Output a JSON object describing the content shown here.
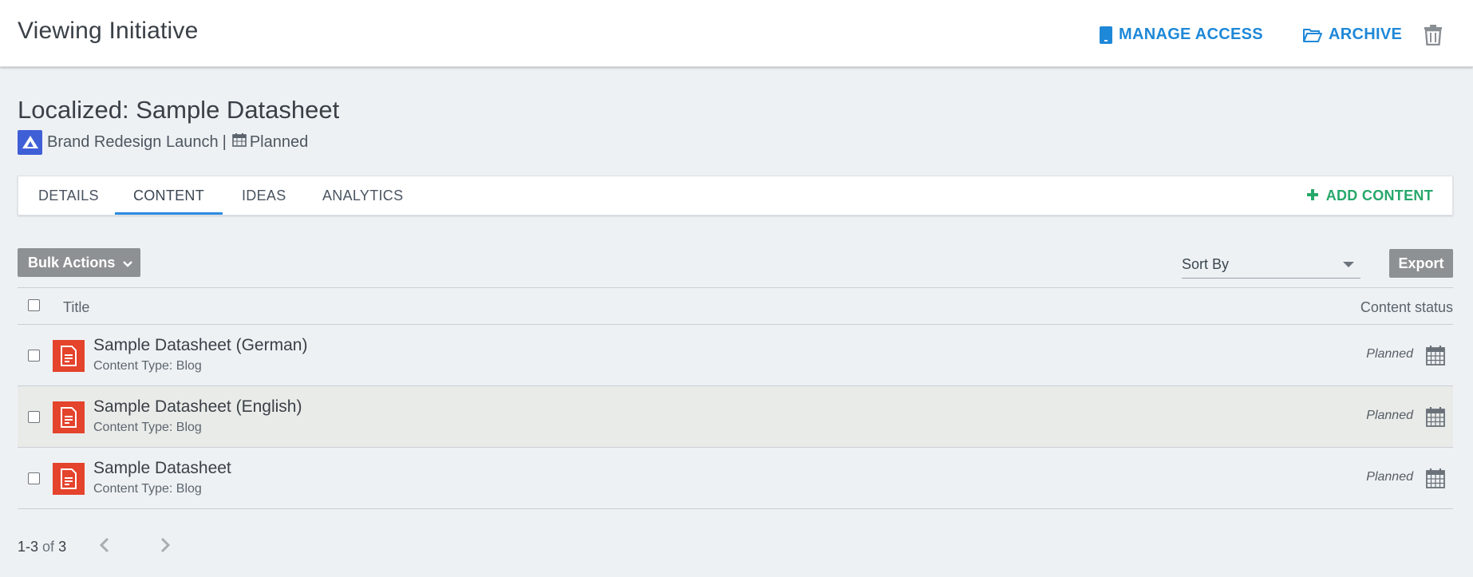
{
  "header": {
    "title": "Viewing Initiative",
    "manage_access_label": "MANAGE ACCESS",
    "archive_label": "ARCHIVE",
    "icons": [
      "tablet-icon",
      "folder-open-icon",
      "trash-icon"
    ]
  },
  "page": {
    "title": "Localized: Sample Datasheet",
    "initiative_name": "Brand Redesign Launch",
    "separator": "|",
    "status": "Planned"
  },
  "tabs": {
    "items": [
      {
        "label": "DETAILS"
      },
      {
        "label": "CONTENT",
        "active": true
      },
      {
        "label": "IDEAS"
      },
      {
        "label": "ANALYTICS"
      }
    ],
    "add_content_label": "ADD CONTENT"
  },
  "toolbar": {
    "bulk_actions_label": "Bulk Actions",
    "sort_by_placeholder": "Sort By",
    "export_label": "Export"
  },
  "table": {
    "columns": [
      "Title",
      "Content status"
    ],
    "rows": [
      {
        "title": "Sample Datasheet (German)",
        "type": "Content Type: Blog",
        "status": "Planned"
      },
      {
        "title": "Sample Datasheet (English)",
        "type": "Content Type: Blog",
        "status": "Planned"
      },
      {
        "title": "Sample Datasheet",
        "type": "Content Type: Blog",
        "status": "Planned"
      }
    ]
  },
  "pagination": {
    "range": "1-3",
    "of_label": "of",
    "total": "3"
  },
  "colors": {
    "accent_blue": "#1e88d8",
    "add_green": "#27a86b",
    "doc_red": "#e4432c",
    "initiative_blue": "#3f5fd6",
    "button_gray": "#8e9193"
  }
}
